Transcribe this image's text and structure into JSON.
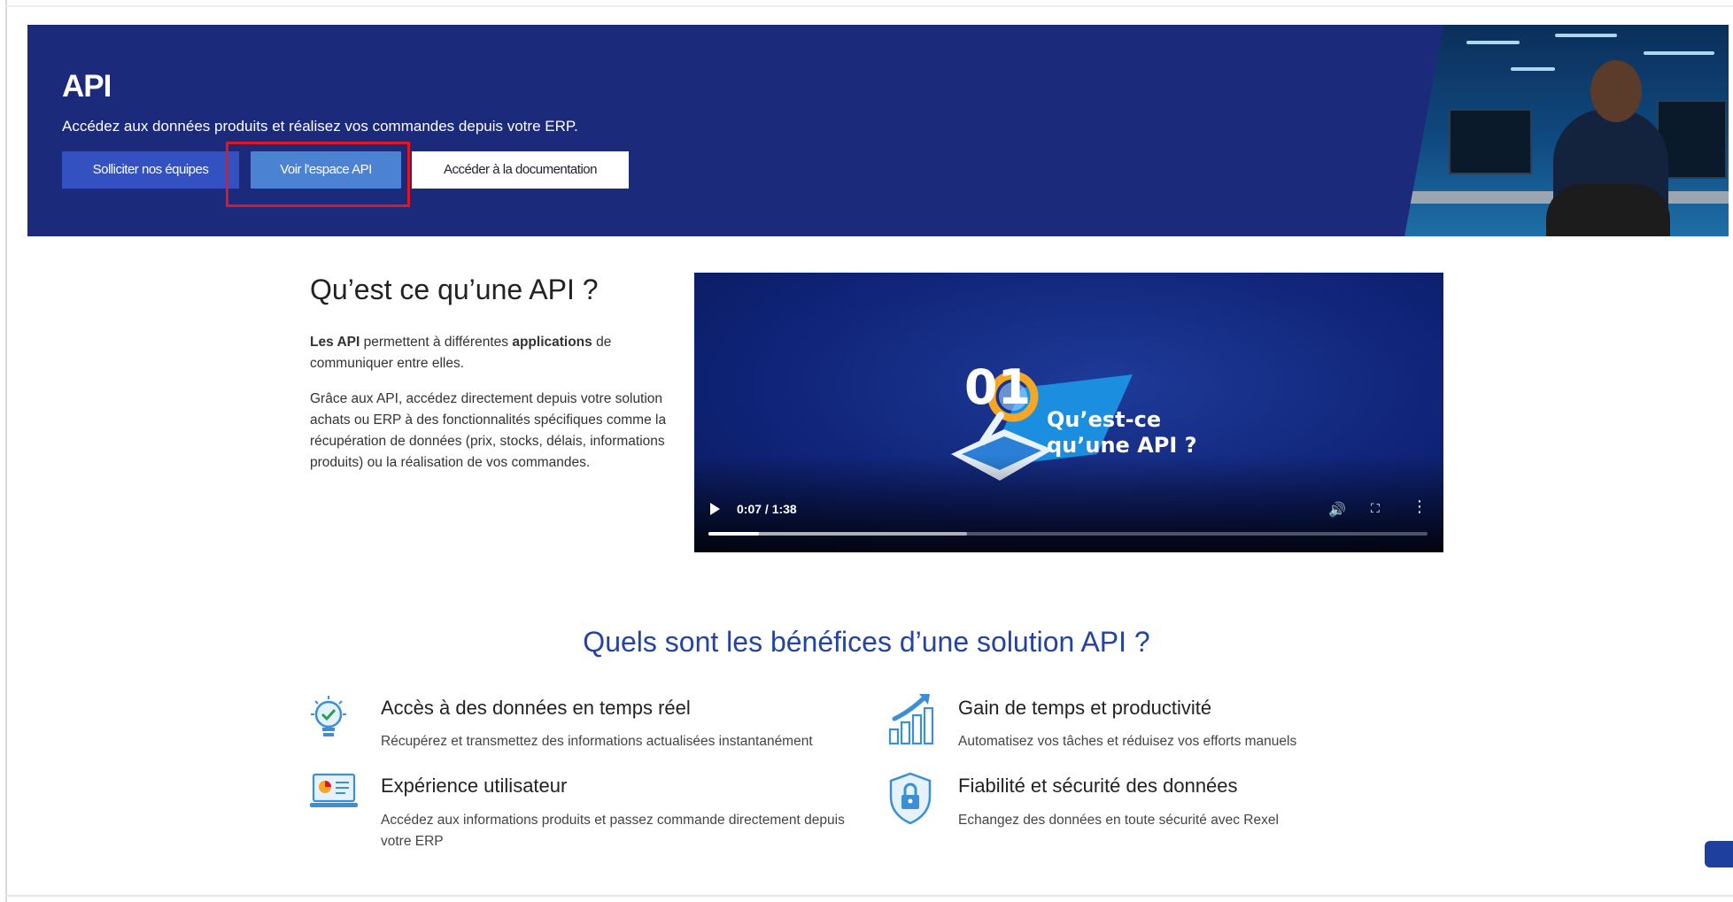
{
  "hero": {
    "title": "API",
    "subtitle": "Accédez aux données produits et réalisez vos commandes depuis votre ERP.",
    "buttons": {
      "teams": "Solliciter nos équipes",
      "api_space": "Voir l'espace API",
      "docs": "Accéder à la documentation"
    }
  },
  "intro": {
    "title": "Qu’est ce qu’une API ?",
    "p1_bold1": "Les API",
    "p1_text1": " permettent à différentes ",
    "p1_bold2": "applications",
    "p1_text2": " de communiquer entre elles.",
    "p2": "Grâce aux API, accédez directement depuis votre solution achats ou ERP à des fonctionnalités spécifiques comme la récupération de données (prix, stocks, délais, informations produits) ou la réalisation de vos commandes."
  },
  "video": {
    "badge_number": "01",
    "caption_line1": "Qu’est-ce",
    "caption_line2": "qu’une API ?",
    "time": "0:07 / 1:38",
    "progress_fraction": 0.07,
    "buffer_fraction": 0.36
  },
  "benefits": {
    "title": "Quels sont les bénéfices d’une solution API ?",
    "items": [
      {
        "title": "Accès à des données en temps réel",
        "desc": "Récupérez et transmettez des informations actualisées instantanément",
        "icon": "lightbulb-icon"
      },
      {
        "title": "Gain de temps et productivité",
        "desc": "Automatisez vos tâches et réduisez vos efforts manuels",
        "icon": "growth-chart-icon"
      },
      {
        "title": "Expérience utilisateur",
        "desc": "Accédez aux informations produits et passez commande directement depuis votre ERP",
        "icon": "laptop-dashboard-icon"
      },
      {
        "title": "Fiabilité et sécurité des données",
        "desc": "Echangez des données en toute sécurité avec Rexel",
        "icon": "shield-lock-icon"
      }
    ]
  },
  "colors": {
    "hero_bg": "#1b2a7a",
    "primary_button": "#3351c1",
    "highlight_button": "#4b82d1",
    "accent_title": "#2343a5",
    "highlight_border": "#e3151e"
  }
}
